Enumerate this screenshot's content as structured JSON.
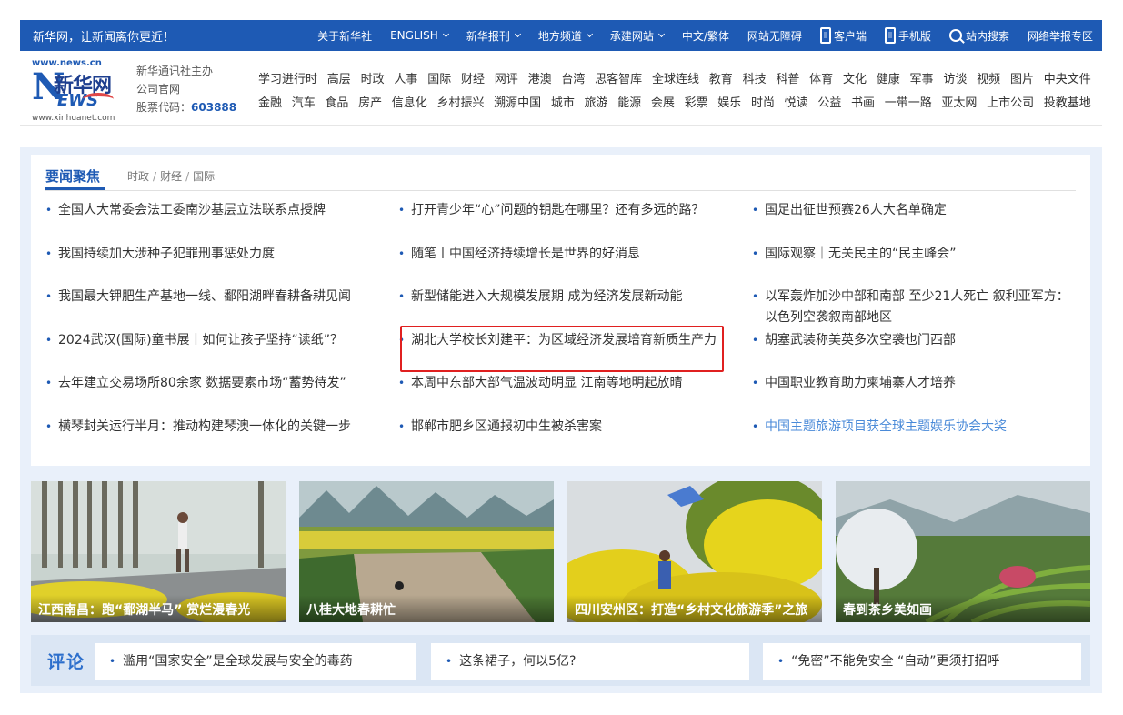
{
  "topbar": {
    "slogan": "新华网，让新闻离你更近！",
    "items": [
      {
        "label": "关于新华社",
        "caret": false
      },
      {
        "label": "ENGLISH",
        "caret": true
      },
      {
        "label": "新华报刊",
        "caret": true
      },
      {
        "label": "地方频道",
        "caret": true
      },
      {
        "label": "承建网站",
        "caret": true
      },
      {
        "label": "中文/繁体",
        "caret": false
      },
      {
        "label": "网站无障碍",
        "caret": false
      }
    ],
    "client": "客户端",
    "mobile": "手机版",
    "search": "站内搜索",
    "report": "网络举报专区"
  },
  "logo": {
    "url_top": "www.news.cn",
    "brand_cn": "新华网",
    "brand_n": "N",
    "brand_ews": "EWS",
    "url_bottom": "www.xinhuanet.com"
  },
  "company": {
    "line1": "新华通讯社主办",
    "line2": "公司官网",
    "stock_label": "股票代码：",
    "stock_code": "603888"
  },
  "categories": {
    "row1": [
      "学习进行时",
      "高层",
      "时政",
      "人事",
      "国际",
      "财经",
      "网评",
      "港澳",
      "台湾",
      "思客智库",
      "全球连线",
      "教育",
      "科技",
      "科普",
      "体育",
      "文化",
      "健康",
      "军事",
      "访谈",
      "视频",
      "图片",
      "中央文件"
    ],
    "row2": [
      "金融",
      "汽车",
      "食品",
      "房产",
      "信息化",
      "乡村振兴",
      "溯源中国",
      "城市",
      "旅游",
      "能源",
      "会展",
      "彩票",
      "娱乐",
      "时尚",
      "悦读",
      "公益",
      "书画",
      "一带一路",
      "亚太网",
      "上市公司",
      "投教基地"
    ]
  },
  "focus": {
    "title": "要闻聚焦",
    "subtabs": [
      "时政",
      "财经",
      "国际"
    ],
    "sep": "/",
    "col1": [
      "全国人大常委会法工委南沙基层立法联系点授牌",
      "我国持续加大涉种子犯罪刑事惩处力度",
      "我国最大钾肥生产基地一线、鄱阳湖畔春耕备耕见闻",
      "2024武汉(国际)童书展丨如何让孩子坚持“读纸”？",
      "去年建立交易场所80余家 数据要素市场“蓄势待发”",
      "横琴封关运行半月：推动构建琴澳一体化的关键一步"
    ],
    "col2": [
      "打开青少年“心”问题的钥匙在哪里？还有多远的路？",
      "随笔丨中国经济持续增长是世界的好消息",
      "新型储能进入大规模发展期 成为经济发展新动能",
      "湖北大学校长刘建平：为区域经济发展培育新质生产力",
      "本周中东部大部气温波动明显 江南等地明起放晴",
      "邯郸市肥乡区通报初中生被杀害案"
    ],
    "col3": [
      "国足出征世预赛26人大名单确定",
      "国际观察｜无关民主的“民主峰会”",
      "以军轰炸加沙中部和南部 至少21人死亡 叙利亚军方：以色列空袭叙南部地区",
      "胡塞武装称美英多次空袭也门西部",
      "中国职业教育助力柬埔寨人才培养",
      "中国主题旅游项目获全球主题娱乐协会大奖"
    ]
  },
  "photos": [
    {
      "caption": "江西南昌：跑“鄱湖半马” 赏烂漫春光"
    },
    {
      "caption": "八桂大地春耕忙"
    },
    {
      "caption": "四川安州区：打造“乡村文化旅游季”之旅"
    },
    {
      "caption": "春到茶乡美如画"
    }
  ],
  "comments": {
    "title": "评论",
    "items": [
      "滥用“国家安全”是全球发展与安全的毒药",
      "这条裙子，何以5亿?",
      "“免密”不能免安全 “自动”更须打招呼"
    ]
  },
  "colors": {
    "brand_blue": "#1e5ab4",
    "highlight_red": "#e02020",
    "light_link": "#4a8ad8"
  }
}
